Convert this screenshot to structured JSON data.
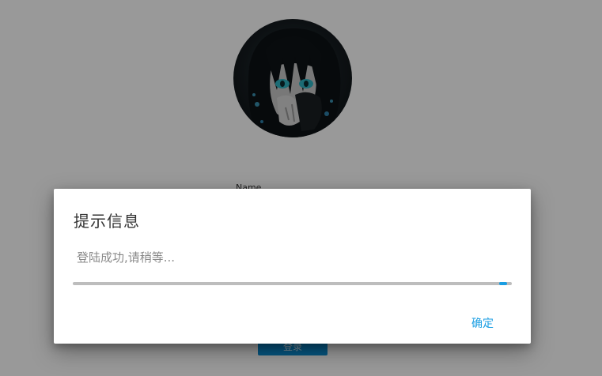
{
  "underlying_page": {
    "name_label": "Name",
    "login_button_label": "登录",
    "primary_color": "#0a8fd6"
  },
  "overlay_color": "rgba(0,0,0,0.40)",
  "dialog": {
    "title": "提示信息",
    "message": "登陆成功,请稍等...",
    "progress_fraction": 0.98,
    "confirm_label": "确定",
    "accent_color": "#1a9ee3"
  }
}
